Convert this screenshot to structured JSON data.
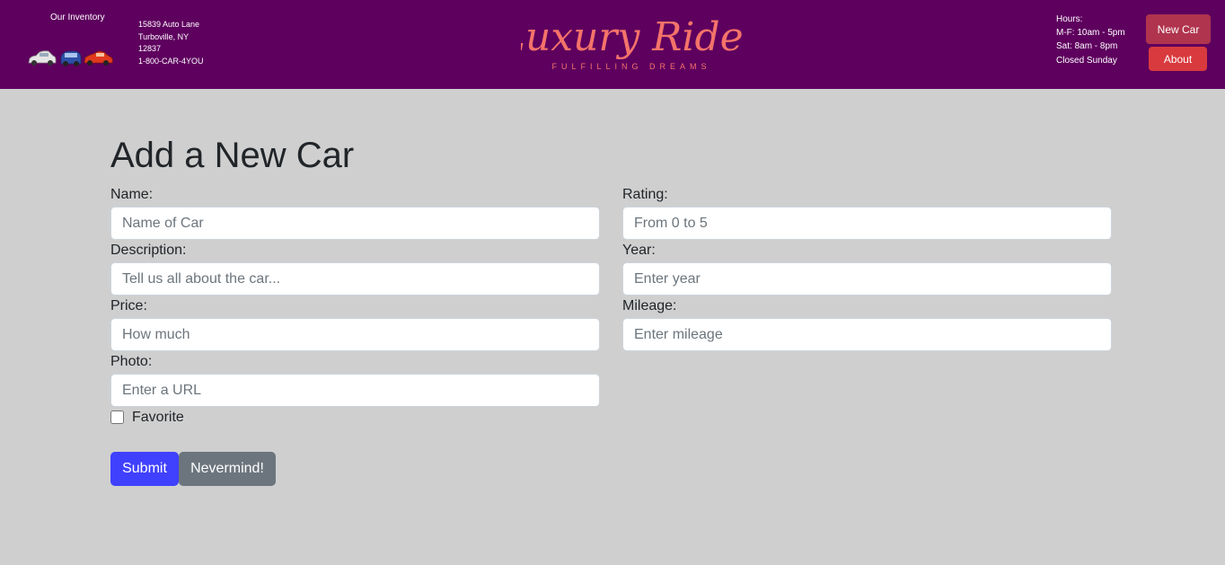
{
  "header": {
    "inventory_label": "Our Inventory",
    "address": {
      "street": "15839 Auto Lane",
      "city": "Turboville, NY",
      "zip": "12837",
      "phone": "1-800-CAR-4YOU"
    },
    "logo": {
      "name": "Luxury Rides",
      "tagline": "FULFILLING DREAMS"
    },
    "hours": {
      "title": "Hours:",
      "weekdays": "M-F: 10am - 5pm",
      "saturday": "Sat: 8am - 8pm",
      "sunday": "Closed Sunday"
    },
    "nav": {
      "new_car": "New Car",
      "about": "About"
    }
  },
  "form": {
    "title": "Add a New Car",
    "fields": {
      "name": {
        "label": "Name:",
        "placeholder": "Name of Car",
        "value": ""
      },
      "description": {
        "label": "Description:",
        "placeholder": "Tell us all about the car...",
        "value": ""
      },
      "price": {
        "label": "Price:",
        "placeholder": "How much",
        "value": ""
      },
      "photo": {
        "label": "Photo:",
        "placeholder": "Enter a URL",
        "value": ""
      },
      "rating": {
        "label": "Rating:",
        "placeholder": "From 0 to 5",
        "value": ""
      },
      "year": {
        "label": "Year:",
        "placeholder": "Enter year",
        "value": ""
      },
      "mileage": {
        "label": "Mileage:",
        "placeholder": "Enter mileage",
        "value": ""
      }
    },
    "favorite": {
      "label": "Favorite",
      "checked": false
    },
    "buttons": {
      "submit": "Submit",
      "cancel": "Nevermind!"
    }
  },
  "colors": {
    "header_bg": "#5e005e",
    "page_bg": "#cfcfcf",
    "logo": "#f4736a",
    "new_car_button": "#b0344e",
    "about_button": "#d93a3e",
    "submit_button": "#4040ff",
    "cancel_button": "#6c757d"
  }
}
